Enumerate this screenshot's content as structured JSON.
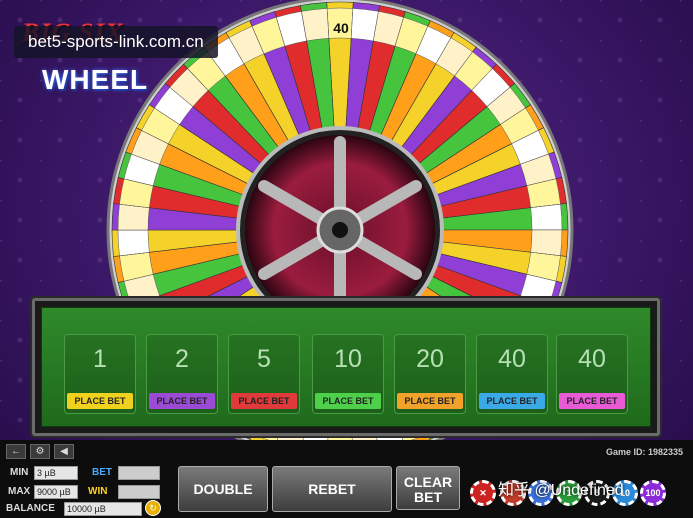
{
  "logo": {
    "line1": "BIG SIX",
    "line2": "WHEEL"
  },
  "watermark": "bet5-sports-link.com.cn",
  "wheel": {
    "top_label": "40",
    "segment_colors": [
      "#f4d22a",
      "#8f3fd6",
      "#e02c2c",
      "#47c43e",
      "#ff9f1a",
      "#e8e8e8"
    ]
  },
  "bets": [
    {
      "value": "1",
      "label": "PLACE BET",
      "color": "#f0d21e"
    },
    {
      "value": "2",
      "label": "PLACE BET",
      "color": "#9b4ad6"
    },
    {
      "value": "5",
      "label": "PLACE BET",
      "color": "#e03a3a"
    },
    {
      "value": "10",
      "label": "PLACE BET",
      "color": "#4fd04a"
    },
    {
      "value": "20",
      "label": "PLACE BET",
      "color": "#f0a22a"
    },
    {
      "value": "40",
      "label": "PLACE BET",
      "color": "#3aa9e8"
    },
    {
      "value": "40",
      "label": "PLACE BET",
      "color": "#e85ad6"
    }
  ],
  "toolbar": {
    "back_icon": "←",
    "settings_icon": "⚙",
    "sound_icon": "◀"
  },
  "game_id": "Game ID: 1982335",
  "stats": {
    "min_label": "MIN",
    "min_value": "3 µB",
    "max_label": "MAX",
    "max_value": "9000 µB",
    "balance_label": "BALANCE",
    "balance_value": "10000 µB",
    "bet_label": "BET",
    "win_label": "WIN"
  },
  "buttons": {
    "double": "DOUBLE",
    "rebet": "REBET",
    "clear_line1": "CLEAR",
    "clear_line2": "BET"
  },
  "chips": [
    {
      "label": "✕",
      "color": "#c22"
    },
    {
      "label": "",
      "color": "#c23b2a"
    },
    {
      "label": "",
      "color": "#3a6fd8"
    },
    {
      "label": "1",
      "color": "#2a9a3a"
    },
    {
      "label": "5",
      "color": "#1a1a1a"
    },
    {
      "label": "10",
      "color": "#2a8ad8"
    },
    {
      "label": "100",
      "color": "#8a2ad8"
    }
  ],
  "watermark2": "知乎 @Undefined"
}
